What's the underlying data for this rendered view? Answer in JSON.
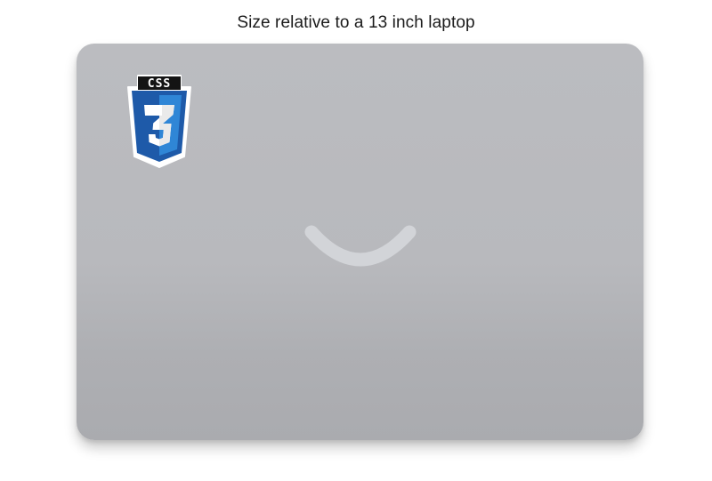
{
  "caption": "Size relative to a 13 inch laptop",
  "sticker": {
    "badge_text": "CSS",
    "icon": "css3-logo-icon"
  },
  "laptop": {
    "icon": "smile-logo-icon"
  },
  "colors": {
    "laptop_body": "#b8b9bd",
    "css_blue_dark": "#1b5fae",
    "css_blue_light": "#2f86d6",
    "smile": "#d4d6da"
  }
}
